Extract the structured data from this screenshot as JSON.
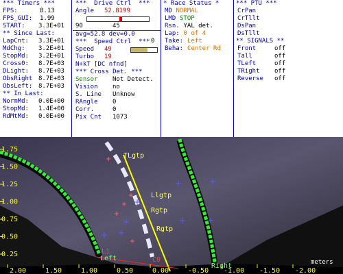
{
  "timers": {
    "header": "*** Timers ***",
    "fps_label": "FPS:",
    "fps": "8.13",
    "fps_gui_label": "FPS_GUI:",
    "fps_gui": "1.99",
    "start_label": "START:",
    "start": "3.3E+01",
    "since_header": "** Since Last:",
    "items": [
      {
        "label": "LapCnt:",
        "value": "3.3E+01"
      },
      {
        "label": "MdChg:",
        "value": "3.2E+01"
      },
      {
        "label": "StopMd:",
        "value": "3.2E+01"
      },
      {
        "label": "Cross0:",
        "value": "8.7E+03"
      },
      {
        "label": "DLight:",
        "value": "8.7E+03"
      },
      {
        "label": "ObsRight",
        "value": "8.7E+03"
      },
      {
        "label": "ObsLeft:",
        "value": "8.7E+03"
      }
    ],
    "inlast_header": "** In Last:",
    "inlast": [
      {
        "label": "NormMd:",
        "value": "0.0E+00"
      },
      {
        "label": "StopMd:",
        "value": "1.4E+00"
      },
      {
        "label": "RdMtMd:",
        "value": "0.0E+00"
      }
    ]
  },
  "drive": {
    "header": "***  Drive Ctrl  ***",
    "angle_label": "Angle",
    "angle": "52.8199",
    "slider_min": "90",
    "slider_max": "0",
    "slider_level": 0.55,
    "slider_value": "45",
    "avg": "avg=52.8 dev=0.0",
    "speed_header": "***  Speed Ctrl  ***",
    "speed_label": "Speed",
    "speed": "49",
    "speed_level": 0.63,
    "turbo_label": "Turbo",
    "turbo": "19",
    "nxkt": "N+kT [DC nfnd]",
    "cross_header": "*** Cross Det. ***",
    "cross": [
      {
        "label": "Sensor",
        "value": "Not Detect."
      },
      {
        "label": "Vision",
        "value": "no"
      },
      {
        "label": "S. Line",
        "value": "Unknow"
      },
      {
        "label": "RAngle",
        "value": "0"
      },
      {
        "label": "Corr.",
        "value": "0"
      },
      {
        "label": "Pix Cnt",
        "value": "1073"
      }
    ]
  },
  "race": {
    "header": "* Race Status *",
    "items": [
      {
        "label": "MD",
        "value": "NORMAL"
      },
      {
        "label": "LMD",
        "value": "STOP"
      },
      {
        "label": "Rsn.",
        "value": "YAL det."
      },
      {
        "label": "Lap:",
        "value": "0 of 4"
      },
      {
        "label": "Take:",
        "value": "Left"
      },
      {
        "label": "Beha:",
        "value": "Center Rd"
      }
    ]
  },
  "ptu": {
    "header": "*** PTU ***",
    "items": [
      "CrPan",
      "CrTllt",
      "DsPan",
      "DsTllt"
    ],
    "signals_header": "** SIGNALS **",
    "signals": [
      {
        "label": "Front",
        "value": "off"
      },
      {
        "label": "Tall",
        "value": "off"
      },
      {
        "label": "TLeft",
        "value": "off"
      },
      {
        "label": "TRight",
        "value": "off"
      },
      {
        "label": "Reverse",
        "value": "off"
      }
    ]
  },
  "camera": {
    "y_ticks": [
      "1.75",
      "1.50",
      "1.25",
      "1.00",
      "0.75",
      "0.50",
      "0.25"
    ],
    "x_ticks": [
      "2.00",
      "1.50",
      "1.00",
      "0.50",
      "0.00",
      "-0.50",
      "-1.00",
      "-1.50",
      "-2.00"
    ],
    "x_axis_label": "meters",
    "labels": {
      "tlgtp": "TLgtp",
      "llgtp": "Llgtp",
      "rgtp": "Rgtp",
      "rgtp2": "Rgtp",
      "left": "Left",
      "right": "Right",
      "l1": "L1",
      "c0": "C0"
    }
  }
}
